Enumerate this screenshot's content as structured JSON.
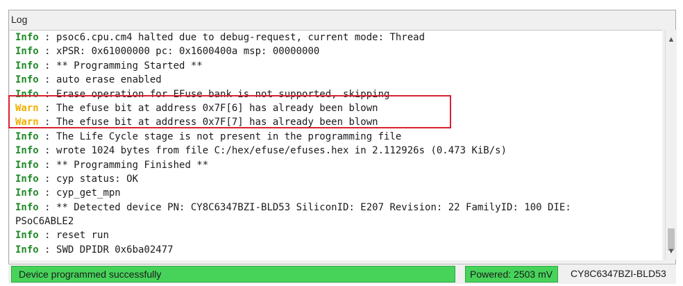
{
  "panel": {
    "title": "Log"
  },
  "log": {
    "lines": [
      {
        "level": "Info",
        "sep": " : ",
        "text": "psoc6.cpu.cm4 halted due to debug-request, current mode: Thread"
      },
      {
        "level": "Info",
        "sep": " : ",
        "text": "xPSR: 0x61000000 pc: 0x1600400a msp: 00000000"
      },
      {
        "level": "Info",
        "sep": " : ",
        "text": "** Programming Started **"
      },
      {
        "level": "Info",
        "sep": " : ",
        "text": "auto erase enabled"
      },
      {
        "level": "Info",
        "sep": " : ",
        "text": "Erase operation for EFuse bank is not supported, skipping"
      },
      {
        "level": "Warn",
        "sep": " : ",
        "text": "The efuse bit at address 0x7F[6] has already been blown"
      },
      {
        "level": "Warn",
        "sep": " : ",
        "text": "The efuse bit at address 0x7F[7] has already been blown"
      },
      {
        "level": "Info",
        "sep": " : ",
        "text": "The Life Cycle stage is not present in the programming file"
      },
      {
        "level": "Info",
        "sep": " : ",
        "text": "wrote 1024 bytes from file C:/hex/efuse/efuses.hex in 2.112926s (0.473 KiB/s)"
      },
      {
        "level": "Info",
        "sep": " : ",
        "text": "** Programming Finished **"
      },
      {
        "level": "Info",
        "sep": " : ",
        "text": "cyp status: OK"
      },
      {
        "level": "Info",
        "sep": " : ",
        "text": "cyp_get_mpn"
      },
      {
        "level": "Info",
        "sep": " : ",
        "text": "** Detected device PN: CY8C6347BZI-BLD53 SiliconID: E207 Revision: 22 FamilyID: 100 DIE:"
      },
      {
        "level": "",
        "sep": "",
        "text": "PSoC6ABLE2"
      },
      {
        "level": "Info",
        "sep": " : ",
        "text": "reset run"
      },
      {
        "level": "Info",
        "sep": " : ",
        "text": "SWD DPIDR 0x6ba02477"
      }
    ]
  },
  "scrollbar": {
    "up_icon": "▲",
    "down_icon": "▼"
  },
  "status": {
    "message": "Device programmed successfully",
    "power": "Powered:  2503 mV",
    "device": "CY8C6347BZI-BLD53"
  },
  "colors": {
    "info": "#1f8a27",
    "warn": "#f0b000",
    "highlight": "#d9202f",
    "status_ok": "#47d35a"
  }
}
